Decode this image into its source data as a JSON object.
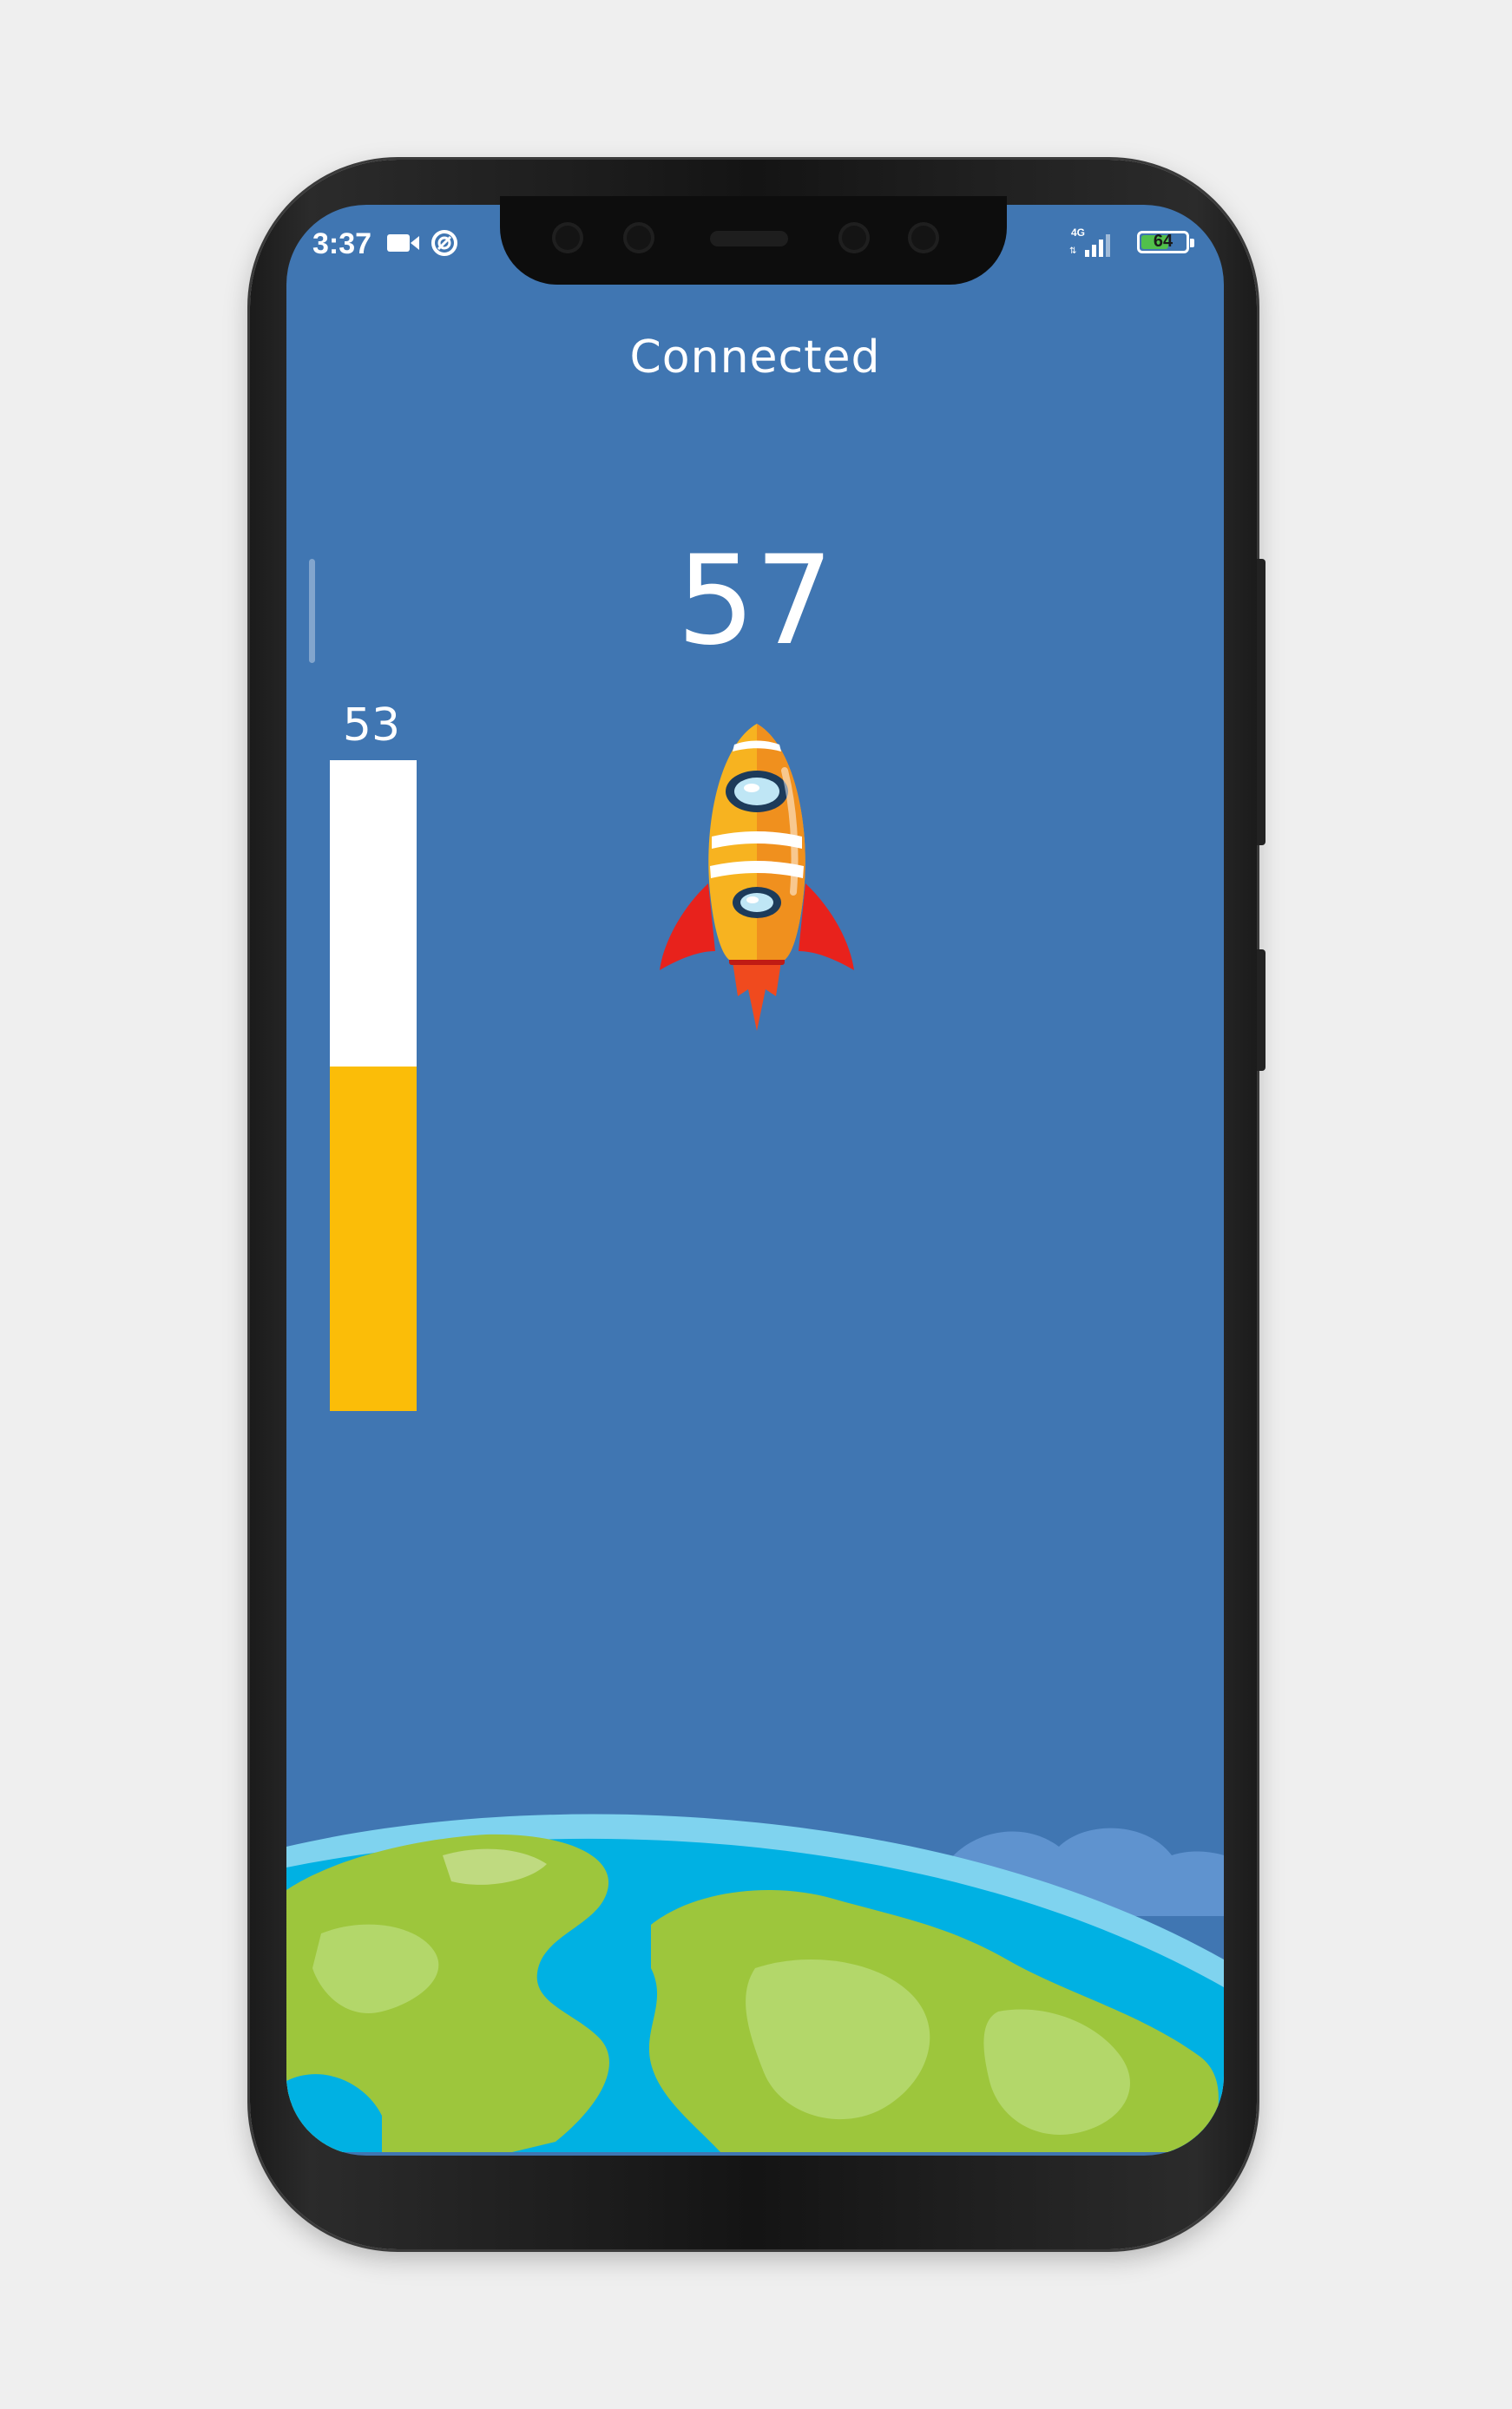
{
  "status_bar": {
    "time": "3:37",
    "network": "4G",
    "battery": "64",
    "battery_level": 0.64,
    "camera_icon": "video-camera-icon",
    "sync_icon": "sync-icon",
    "signal_icon": "cell-signal-icon",
    "battery_icon": "battery-icon"
  },
  "main": {
    "connection_status": "Connected",
    "score": "57",
    "level_label": "53",
    "level_value": 53,
    "level_max": 100,
    "rocket_icon": "rocket-icon",
    "earth_icon": "earth-illustration"
  },
  "colors": {
    "background": "#4076b2",
    "level_fill": "#fbbd08",
    "level_track": "#ffffff",
    "text": "#ffffff"
  }
}
